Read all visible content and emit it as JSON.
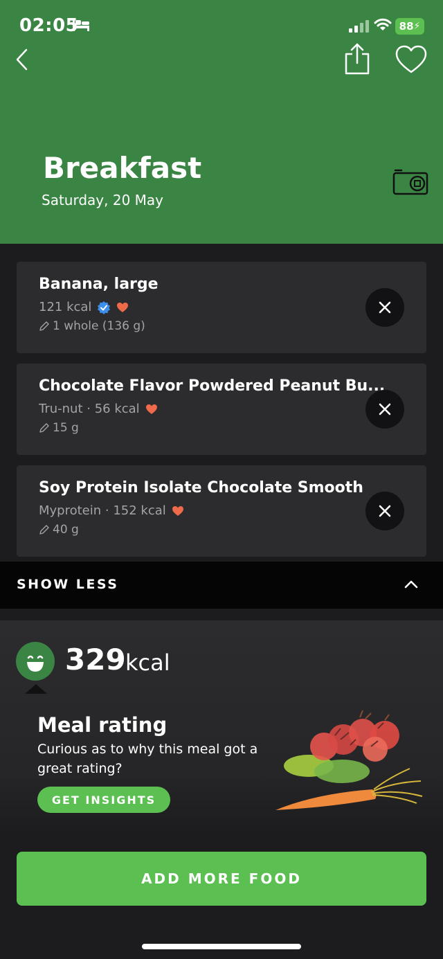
{
  "status_bar": {
    "time": "02:05",
    "battery": "88"
  },
  "header": {
    "title": "Breakfast",
    "date": "Saturday, 20 May"
  },
  "foods": [
    {
      "name": "Banana, large",
      "brand": "",
      "kcal": "121 kcal",
      "verified": true,
      "favorite": true,
      "portion": "1 whole (136 g)"
    },
    {
      "name": "Chocolate Flavor Powdered Peanut Bu...",
      "brand": "Tru-nut",
      "kcal": "56 kcal",
      "verified": false,
      "favorite": true,
      "portion": "15 g"
    },
    {
      "name": "Soy Protein Isolate Chocolate Smooth",
      "brand": "Myprotein",
      "kcal": "152 kcal",
      "verified": false,
      "favorite": true,
      "portion": "40 g"
    }
  ],
  "separator": " · ",
  "show_less_label": "SHOW LESS",
  "summary": {
    "kcal_value": "329",
    "kcal_unit": "kcal"
  },
  "rating": {
    "title": "Meal rating",
    "description": "Curious as to why this meal got a great rating?",
    "insights_label": "GET INSIGHTS"
  },
  "add_food_label": "ADD MORE FOOD",
  "colors": {
    "header_green": "#3b8544",
    "accent_green": "#5cbf52",
    "heart": "#ee6a4a",
    "verified": "#3d8ee8",
    "card": "#2c2c2e"
  },
  "icons": [
    "back-icon",
    "share-icon",
    "heart-outline-icon",
    "camera-icon",
    "verified-badge-icon",
    "heart-filled-icon",
    "pencil-icon",
    "close-icon",
    "chevron-up-icon",
    "smile-icon"
  ]
}
